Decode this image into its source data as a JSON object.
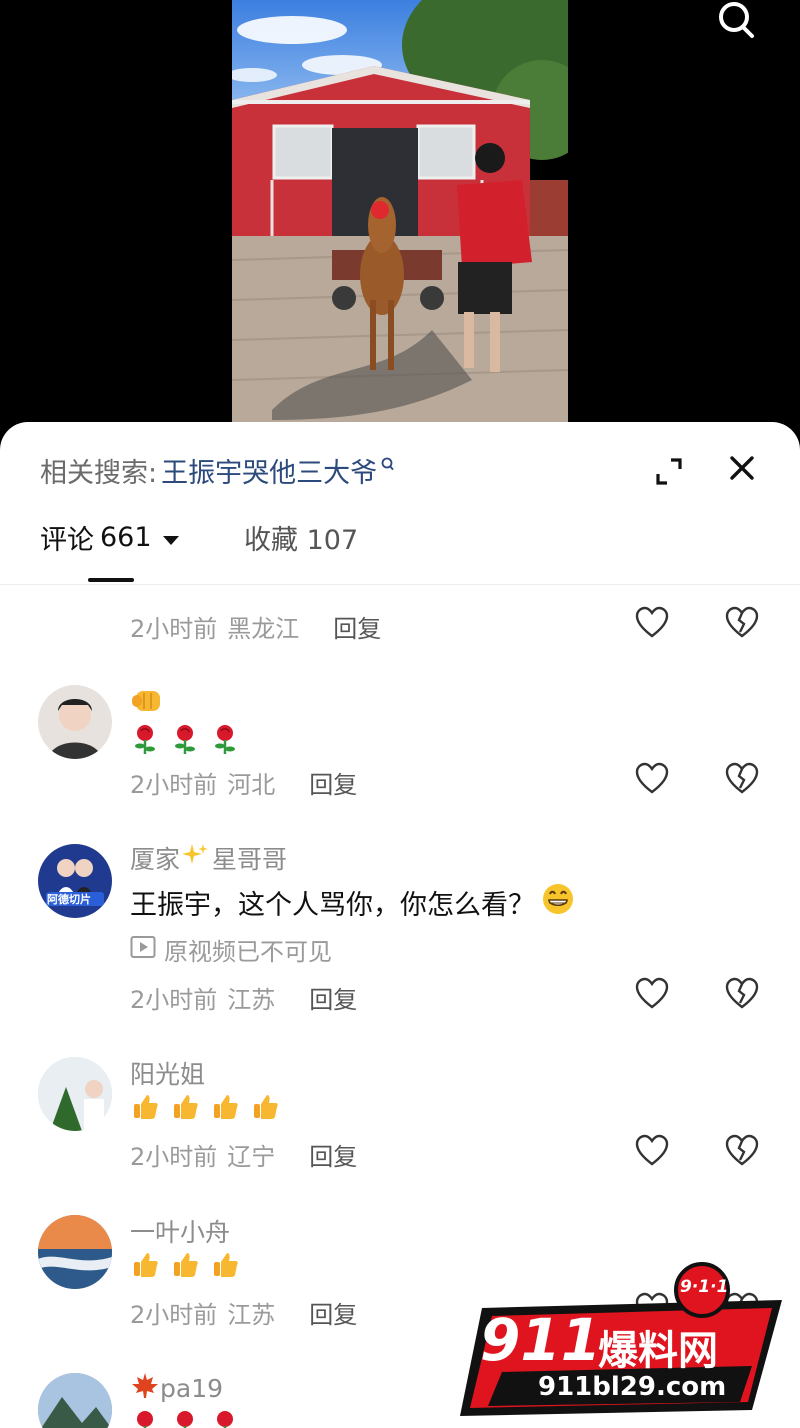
{
  "video": {
    "search_icon": "search-icon"
  },
  "sheet": {
    "related_label": "相关搜索:",
    "related_term": "王振宇哭他三大爷",
    "tabs": {
      "comments_label": "评论",
      "comments_count": "661",
      "favorites_label": "收藏",
      "favorites_count": "107"
    }
  },
  "comments": [
    {
      "time": "2小时前",
      "location": "黑龙江",
      "reply": "回复"
    },
    {
      "emoji_lines": [
        "fist",
        "roses"
      ],
      "time": "2小时前",
      "location": "河北",
      "reply": "回复"
    },
    {
      "name_prefix": "厦家",
      "name_suffix": "星哥哥",
      "avatar_text": "阿德切片",
      "text": "王振宇，这个人骂你，你怎么看？",
      "note": "原视频已不可见",
      "time": "2小时前",
      "location": "江苏",
      "reply": "回复"
    },
    {
      "name": "阳光姐",
      "time": "2小时前",
      "location": "辽宁",
      "reply": "回复"
    },
    {
      "name": "一叶小舟",
      "time": "2小时前",
      "location": "江苏",
      "reply": "回复"
    },
    {
      "name": "pa19"
    }
  ],
  "watermark": {
    "brand_number": "911",
    "brand_text": "爆料网",
    "badge": "9·1·1",
    "url": "911bl29.com"
  },
  "colors": {
    "link": "#2d4a7c",
    "meta": "#9a9a9a",
    "watermark_red": "#e0141e"
  }
}
